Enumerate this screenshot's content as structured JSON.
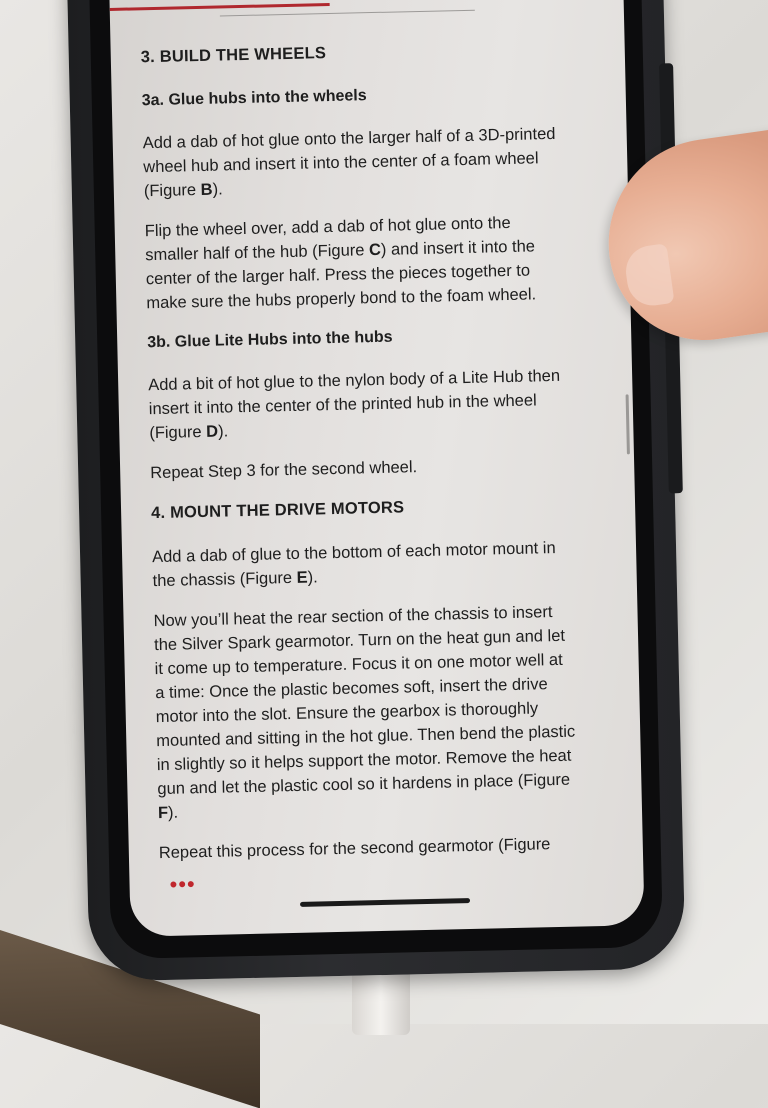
{
  "article": {
    "step3_heading": "3. BUILD THE WHEELS",
    "step3a_heading": "3a. Glue hubs into the wheels",
    "p1_a": "Add a dab of hot glue onto the larger half of a 3D-printed wheel hub and insert it into the center of a foam wheel (Figure ",
    "p1_fig": "B",
    "p1_b": ").",
    "p2_a": "Flip the wheel over, add a dab of hot glue onto the smaller half of the hub (Figure ",
    "p2_fig": "C",
    "p2_b": ") and insert it into the center of the larger half. Press the pieces together to make sure the hubs properly bond to the foam wheel.",
    "step3b_heading": "3b. Glue Lite Hubs into the hubs",
    "p3_a": "Add a bit of hot glue to the nylon body of a Lite Hub then insert it into the center of the printed hub in the wheel (Figure ",
    "p3_fig": "D",
    "p3_b": ").",
    "p4": "Repeat Step 3 for the second wheel.",
    "step4_heading": "4. MOUNT THE DRIVE MOTORS",
    "p5_a": "Add a dab of glue to the bottom of each motor mount in the chassis (Figure ",
    "p5_fig": "E",
    "p5_b": ").",
    "p6_a": "Now you’ll heat the rear section of the chassis to insert the Silver Spark gearmotor. Turn on the heat gun and let it come up to temperature. Focus it on one motor well at a time: Once the plastic becomes soft, insert the drive motor into the slot. Ensure the gearbox is thoroughly mounted and sitting in the hot glue. Then bend the plastic in slightly so it helps support the motor. Remove the heat gun and let the plastic cool so it hardens in place (Figure ",
    "p6_fig": "F",
    "p6_b": ").",
    "p7_cut": "Repeat this process for the second gearmotor (Figure"
  },
  "ui": {
    "menu_dots": "•••"
  },
  "colors": {
    "accent_red": "#b0282e",
    "text": "#1e1e1e",
    "screen_bg": "#e2dfdd"
  }
}
